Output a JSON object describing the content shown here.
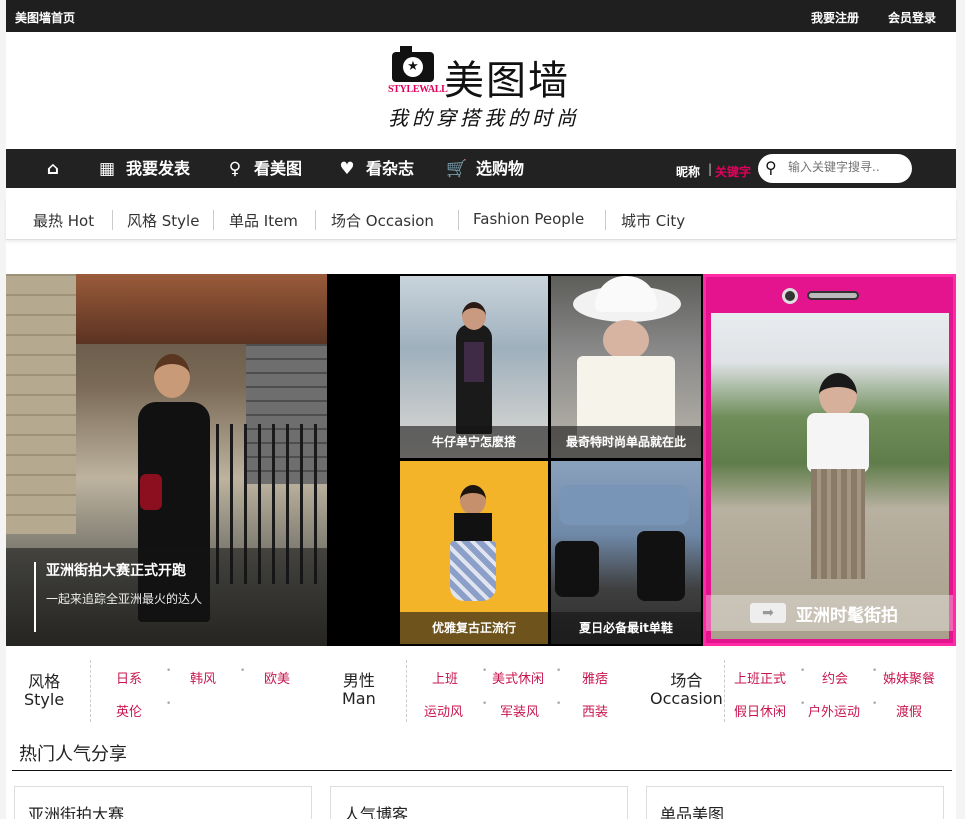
{
  "topbar": {
    "home": "美图墙首页",
    "register": "我要注册",
    "login": "会员登录"
  },
  "logo": {
    "brand": "美图墙",
    "sub_brand": "STYLEWALL",
    "slogan": "我的穿搭我的时尚"
  },
  "mainnav": {
    "items": [
      {
        "label": "",
        "icon": "home-icon"
      },
      {
        "label": "我要发表",
        "icon": "grid-icon"
      },
      {
        "label": "看美图",
        "icon": "dress-icon"
      },
      {
        "label": "看杂志",
        "icon": "heart-icon"
      },
      {
        "label": "选购物",
        "icon": "cart-icon"
      }
    ],
    "nickname": "昵称",
    "separator": "|",
    "keyword": "关键字",
    "search_placeholder": "输入关键字搜寻.."
  },
  "subnav": [
    "最热 Hot",
    "风格 Style",
    "单品 Item",
    "场合 Occasion",
    "Fashion People",
    "城市 City"
  ],
  "hero": {
    "main": {
      "title": "亚洲街拍大赛正式开跑",
      "subtitle": "一起来追踪全亚洲最火的达人"
    },
    "tiles": [
      "牛仔单宁怎麽搭",
      "最奇特时尚单品就在此",
      "优雅复古正流行",
      "夏日必备最it单鞋"
    ],
    "phone_banner": "亚洲时髦街拍"
  },
  "categories": {
    "style": {
      "cn": "风格",
      "en": "Style",
      "links": [
        "日系",
        "韩风",
        "欧美",
        "英伦"
      ]
    },
    "men": {
      "cn": "男性",
      "en": "Man",
      "links": [
        "上班",
        "美式休闲",
        "雅痞",
        "运动风",
        "军装风",
        "西装"
      ]
    },
    "occasion": {
      "cn": "场合",
      "en": "Occasion",
      "links": [
        "上班正式",
        "约会",
        "姊妹聚餐",
        "假日休闲",
        "户外运动",
        "渡假"
      ]
    }
  },
  "hot": {
    "title": "热门人气分享",
    "cards": [
      "亚洲街拍大赛",
      "人气博客",
      "单品美图"
    ]
  },
  "colors": {
    "accent": "#e0005c",
    "nav_bg": "#222222",
    "link": "#c8174f",
    "phone_pink": "#e3148d"
  }
}
